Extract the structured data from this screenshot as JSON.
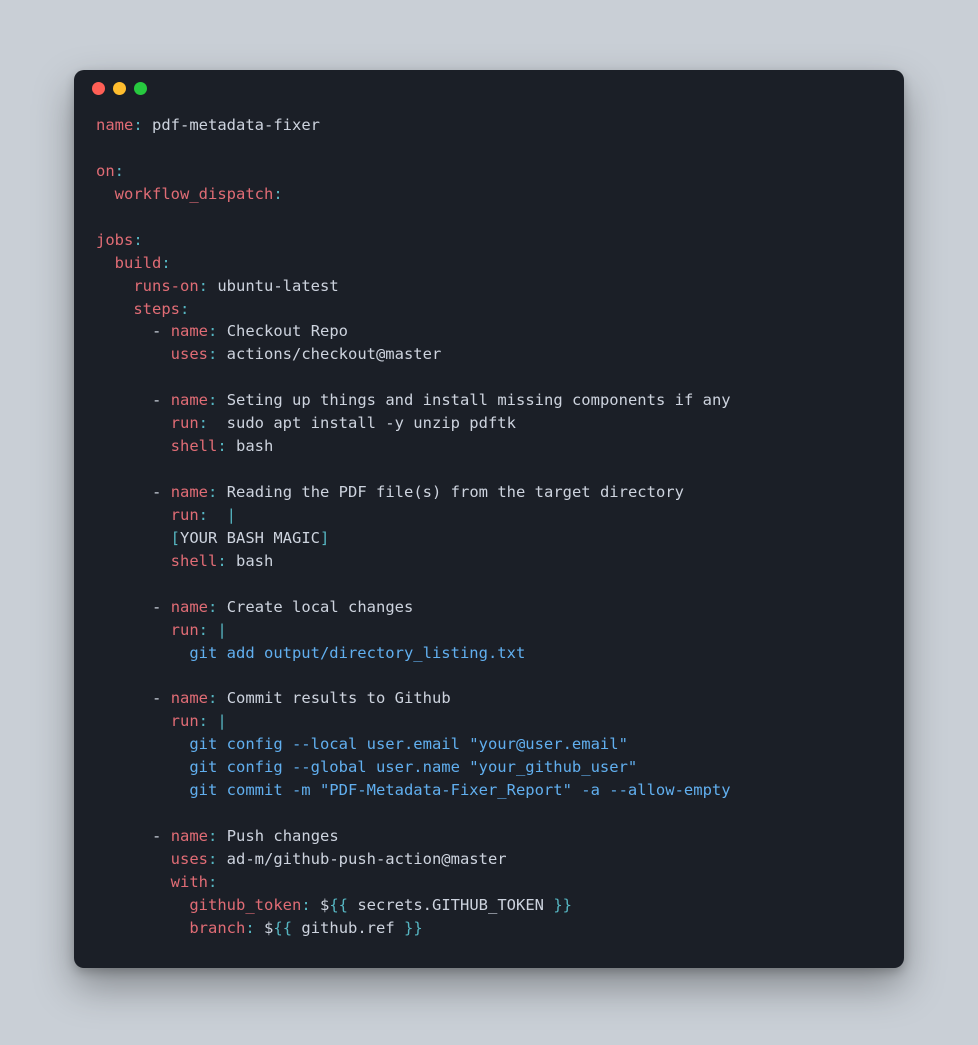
{
  "yaml": {
    "name_key": "name",
    "name_val": "pdf-metadata-fixer",
    "on_key": "on",
    "workflow_dispatch": "workflow_dispatch",
    "jobs_key": "jobs",
    "build_key": "build",
    "runs_on_key": "runs-on",
    "runs_on_val": "ubuntu-latest",
    "steps_key": "steps",
    "step1": {
      "name_key": "name",
      "name_val": "Checkout Repo",
      "uses_key": "uses",
      "uses_val": "actions/checkout@master"
    },
    "step2": {
      "name_key": "name",
      "name_val": "Seting up things and install missing components if any",
      "run_key": "run",
      "run_val": "sudo apt install -y unzip pdftk",
      "shell_key": "shell",
      "shell_val": "bash"
    },
    "step3": {
      "name_key": "name",
      "name_val": "Reading the PDF file(s) from the target directory",
      "run_key": "run",
      "pipe": "|",
      "magic": "YOUR BASH MAGIC",
      "shell_key": "shell",
      "shell_val": "bash"
    },
    "step4": {
      "name_key": "name",
      "name_val": "Create local changes",
      "run_key": "run",
      "pipe": "|",
      "cmd1": "git add output/directory_listing.txt"
    },
    "step5": {
      "name_key": "name",
      "name_val": "Commit results to Github",
      "run_key": "run",
      "pipe": "|",
      "cmd1": "git config --local user.email \"your@user.email\"",
      "cmd2": "git config --global user.name \"your_github_user\"",
      "cmd3": "git commit -m \"PDF-Metadata-Fixer_Report\" -a --allow-empty"
    },
    "step6": {
      "name_key": "name",
      "name_val": "Push changes",
      "uses_key": "uses",
      "uses_val": "ad-m/github-push-action@master",
      "with_key": "with",
      "github_token_key": "github_token",
      "github_token_val_prefix": "$",
      "github_token_open": "{{",
      "github_token_body": " secrets.GITHUB_TOKEN ",
      "github_token_close": "}}",
      "branch_key": "branch",
      "branch_val_prefix": "$",
      "branch_open": "{{",
      "branch_body": " github.ref ",
      "branch_close": "}}"
    }
  }
}
